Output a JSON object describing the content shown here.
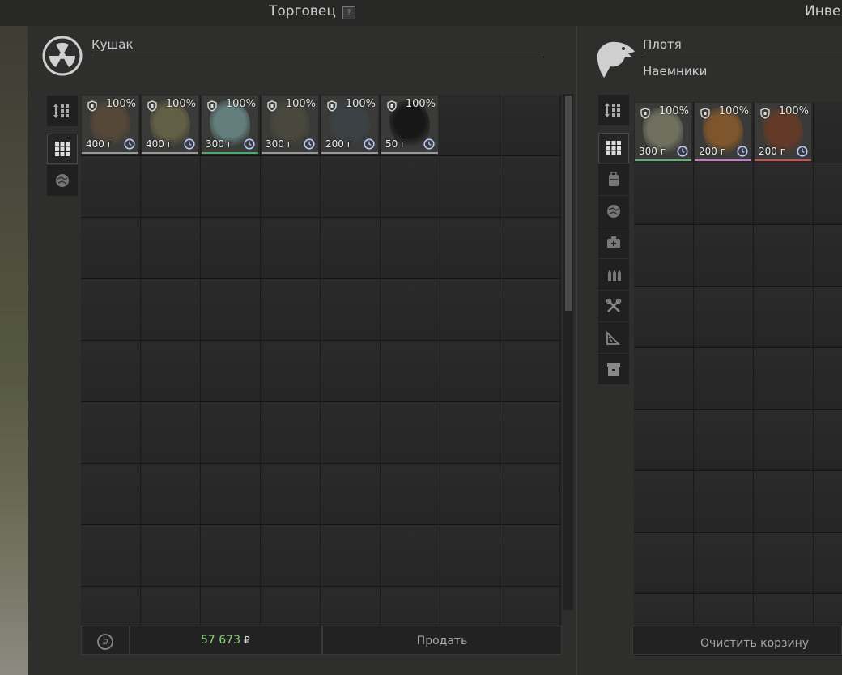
{
  "window": {
    "title_trader": "Торговец",
    "help_label": "?",
    "title_inventory": "Инве"
  },
  "trader": {
    "name": "Кушак",
    "logo_icon": "radiation-icon",
    "items": [
      {
        "pct": "100%",
        "price": "400 г",
        "bar": "#9a9a9a",
        "art": "#5a4a38"
      },
      {
        "pct": "100%",
        "price": "400 г",
        "bar": "#9a9a9a",
        "art": "#6a6448"
      },
      {
        "pct": "100%",
        "price": "300 г",
        "bar": "#4faa6a",
        "art": "#6a8a88"
      },
      {
        "pct": "100%",
        "price": "300 г",
        "bar": "#9a9a9a",
        "art": "#4a4a40"
      },
      {
        "pct": "100%",
        "price": "200 г",
        "bar": "#9a9a9a",
        "art": "#3a4448"
      },
      {
        "pct": "100%",
        "price": "50 г",
        "bar": "#9a9a9a",
        "art": "#111111"
      }
    ]
  },
  "player": {
    "name": "Плотя",
    "faction": "Наемники",
    "logo_icon": "eagle-icon",
    "items": [
      {
        "pct": "100%",
        "price": "300 г",
        "bar": "#5fb07a",
        "art": "#7a7a66"
      },
      {
        "pct": "100%",
        "price": "200 г",
        "bar": "#c878c8",
        "art": "#8a5a2a"
      },
      {
        "pct": "100%",
        "price": "200 г",
        "bar": "#d05050",
        "art": "#6a3a24"
      }
    ]
  },
  "footer": {
    "money": "57 673",
    "currency": "₽",
    "sell_label": "Продать",
    "clear_label": "Очистить корзину"
  }
}
